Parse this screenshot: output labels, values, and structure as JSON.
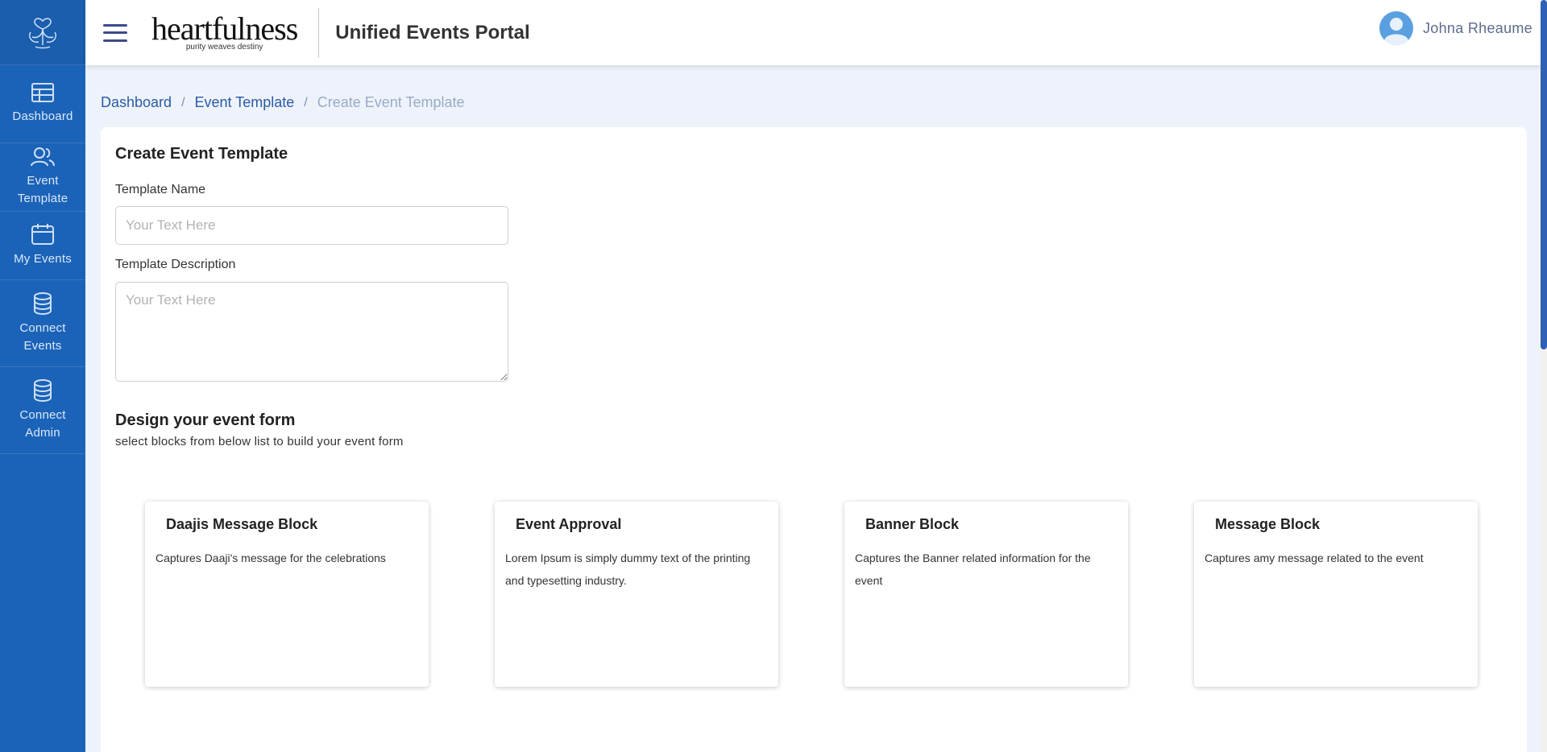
{
  "app": {
    "brand_name": "heartfulness",
    "brand_tagline": "purity weaves destiny",
    "portal_title": "Unified Events Portal"
  },
  "user": {
    "name": "Johna Rheaume"
  },
  "sidebar": {
    "items": [
      {
        "label": "Dashboard",
        "icon": "dashboard-icon"
      },
      {
        "label": "Event Template",
        "icon": "users-icon"
      },
      {
        "label": "My Events",
        "icon": "calendar-icon"
      },
      {
        "label": "Connect Events",
        "icon": "database-icon"
      },
      {
        "label": "Connect Admin",
        "icon": "database-icon"
      }
    ]
  },
  "breadcrumb": {
    "items": [
      "Dashboard",
      "Event Template",
      "Create Event Template"
    ],
    "separator": "/"
  },
  "form": {
    "heading": "Create Event Template",
    "name_label": "Template Name",
    "name_placeholder": "Your Text Here",
    "name_value": "",
    "description_label": "Template Description",
    "description_placeholder": "Your Text Here",
    "description_value": ""
  },
  "design": {
    "title": "Design your event form",
    "subtitle": "select blocks from below list to build your event form",
    "blocks": [
      {
        "title": "Daajis Message Block",
        "description": "Captures Daaji's message for the celebrations"
      },
      {
        "title": "Event Approval",
        "description": "Lorem Ipsum is simply dummy text of the printing and typesetting industry."
      },
      {
        "title": "Banner Block",
        "description": "Captures the Banner related information for the event"
      },
      {
        "title": "Message Block",
        "description": "Captures amy message related to the event"
      }
    ]
  },
  "colors": {
    "sidebar_bg": "#1b63b8",
    "accent": "#2b5aa6",
    "page_bg": "#eef3fb"
  }
}
